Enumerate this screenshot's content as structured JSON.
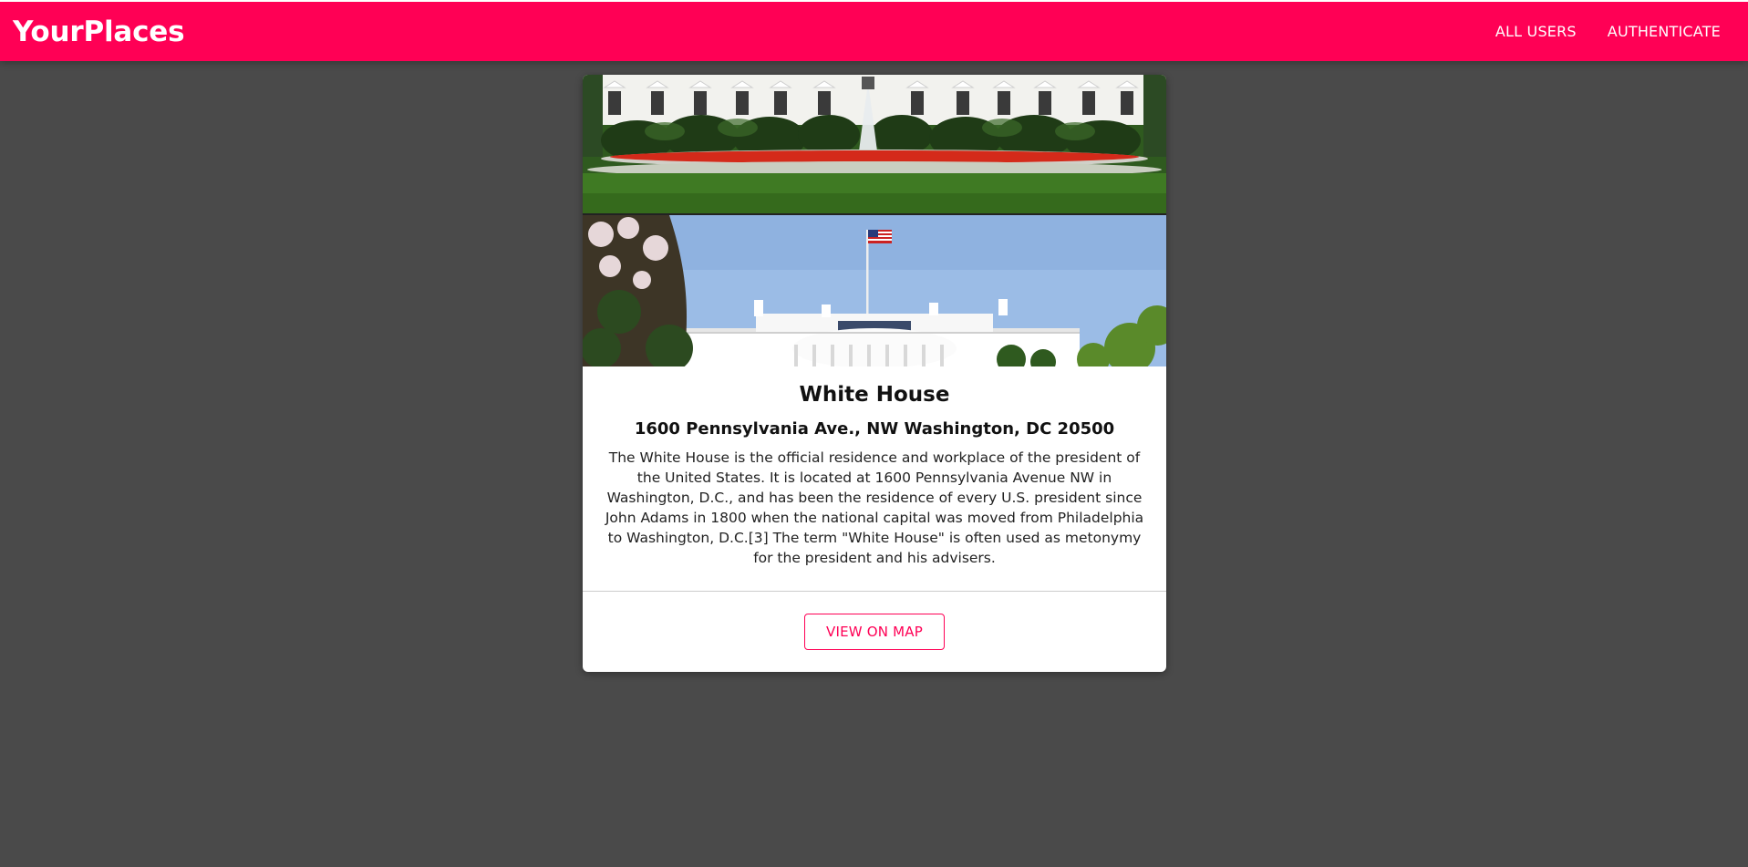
{
  "app": {
    "brand": "YourPlaces",
    "accent_color": "#ff0055",
    "background_color": "#4a4a4a"
  },
  "nav": {
    "items": [
      {
        "label": "ALL USERS"
      },
      {
        "label": "AUTHENTICATE"
      }
    ]
  },
  "place": {
    "image_icon": "white-house-photo",
    "title": "White House",
    "address": "1600 Pennsylvania Ave., NW Washington, DC 20500",
    "description": "The White House is the official residence and workplace of the president of the United States. It is located at 1600 Pennsylvania Avenue NW in Washington, D.C., and has been the residence of every U.S. president since John Adams in 1800 when the national capital was moved from Philadelphia to Washington, D.C.[3] The term \"White House\" is often used as metonymy for the president and his advisers.",
    "actions": {
      "view_on_map": "VIEW ON MAP"
    }
  }
}
